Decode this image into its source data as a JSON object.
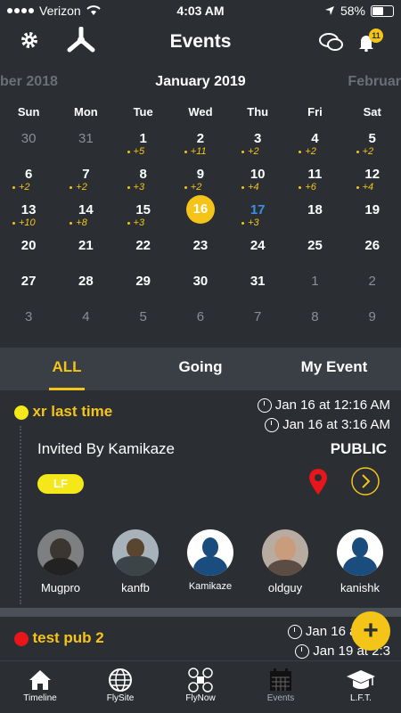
{
  "status": {
    "carrier": "Verizon",
    "time": "4:03 AM",
    "battery": "58%"
  },
  "header": {
    "title": "Events",
    "badge": "11"
  },
  "calendar": {
    "prev_month": "ber 2018",
    "month": "January 2019",
    "next_month": "Februar",
    "weekdays": [
      "Sun",
      "Mon",
      "Tue",
      "Wed",
      "Thu",
      "Fri",
      "Sat"
    ],
    "days": [
      {
        "d": "30",
        "dim": true
      },
      {
        "d": "31",
        "dim": true
      },
      {
        "d": "1",
        "m": "+5"
      },
      {
        "d": "2",
        "m": "+11"
      },
      {
        "d": "3",
        "m": "+2"
      },
      {
        "d": "4",
        "m": "+2"
      },
      {
        "d": "5",
        "m": "+2"
      },
      {
        "d": "6",
        "m": "+2"
      },
      {
        "d": "7",
        "m": "+2"
      },
      {
        "d": "8",
        "m": "+3"
      },
      {
        "d": "9",
        "m": "+2"
      },
      {
        "d": "10",
        "m": "+4"
      },
      {
        "d": "11",
        "m": "+6"
      },
      {
        "d": "12",
        "m": "+4"
      },
      {
        "d": "13",
        "m": "+10"
      },
      {
        "d": "14",
        "m": "+8"
      },
      {
        "d": "15",
        "m": "+3"
      },
      {
        "d": "16",
        "today": true
      },
      {
        "d": "17",
        "m": "+3",
        "blue": true
      },
      {
        "d": "18"
      },
      {
        "d": "19"
      },
      {
        "d": "20"
      },
      {
        "d": "21"
      },
      {
        "d": "22"
      },
      {
        "d": "23"
      },
      {
        "d": "24"
      },
      {
        "d": "25"
      },
      {
        "d": "26"
      },
      {
        "d": "27"
      },
      {
        "d": "28"
      },
      {
        "d": "29"
      },
      {
        "d": "30"
      },
      {
        "d": "31"
      },
      {
        "d": "1",
        "dim": true
      },
      {
        "d": "2",
        "dim": true
      },
      {
        "d": "3",
        "dim": true
      },
      {
        "d": "4",
        "dim": true
      },
      {
        "d": "5",
        "dim": true
      },
      {
        "d": "6",
        "dim": true
      },
      {
        "d": "7",
        "dim": true
      },
      {
        "d": "8",
        "dim": true
      },
      {
        "d": "9",
        "dim": true
      }
    ]
  },
  "tabs": [
    "ALL",
    "Going",
    "My Event"
  ],
  "events": [
    {
      "name": "xr last time",
      "dot_color": "#f4e81a",
      "start": "Jan 16 at 12:16 AM",
      "end": "Jan 16 at 3:16 AM",
      "invited_by": "Invited By Kamikaze",
      "visibility": "PUBLIC",
      "tag": "LF",
      "attendees": [
        "Mugpro",
        "kanfb",
        "Kamikaze",
        "oldguy",
        "kanishk"
      ]
    },
    {
      "name": "test pub 2",
      "dot_color": "#e8161a",
      "start": "Jan 16 at 12:3",
      "end": "Jan 19 at 2:3"
    }
  ],
  "nav": [
    "Timeline",
    "FlySite",
    "FlyNow",
    "Events",
    "L.F.T."
  ]
}
